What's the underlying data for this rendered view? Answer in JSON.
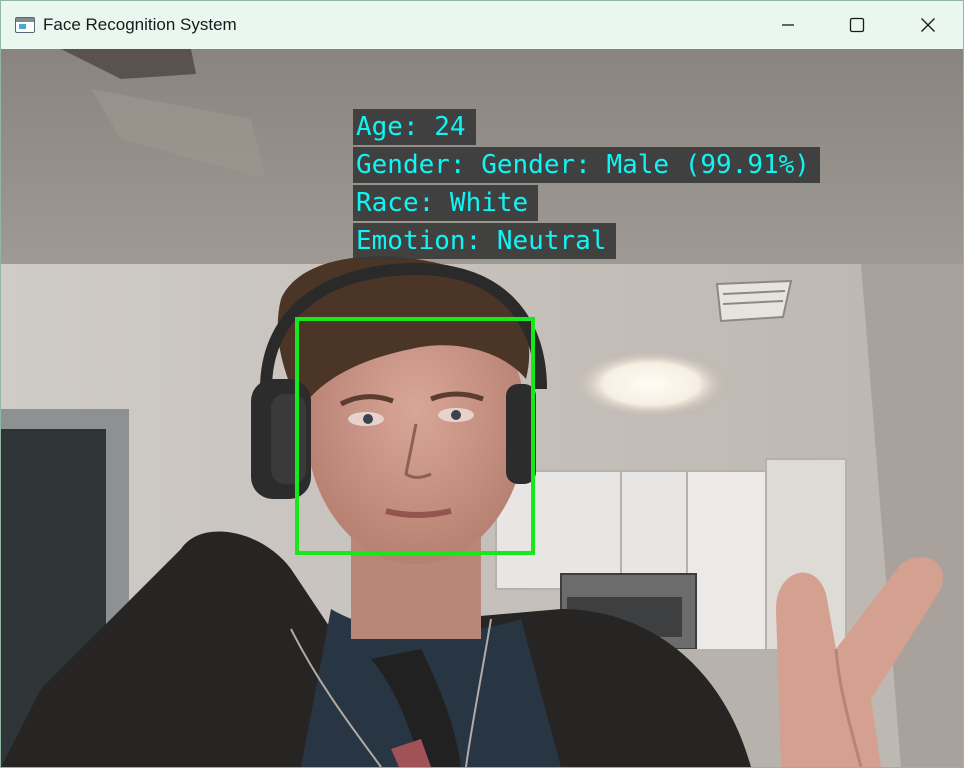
{
  "window": {
    "title": "Face Recognition System",
    "controls": {
      "minimize_icon": "minimize-icon",
      "maximize_icon": "maximize-icon",
      "close_icon": "close-icon"
    }
  },
  "detection": {
    "age_text": "Age: 24",
    "gender_text": "Gender: Gender: Male (99.91%)",
    "race_text": "Race: White",
    "emotion_text": "Emotion: Neutral",
    "overlay_text_color": "#0ff5f5",
    "box_color": "#16e81c"
  }
}
